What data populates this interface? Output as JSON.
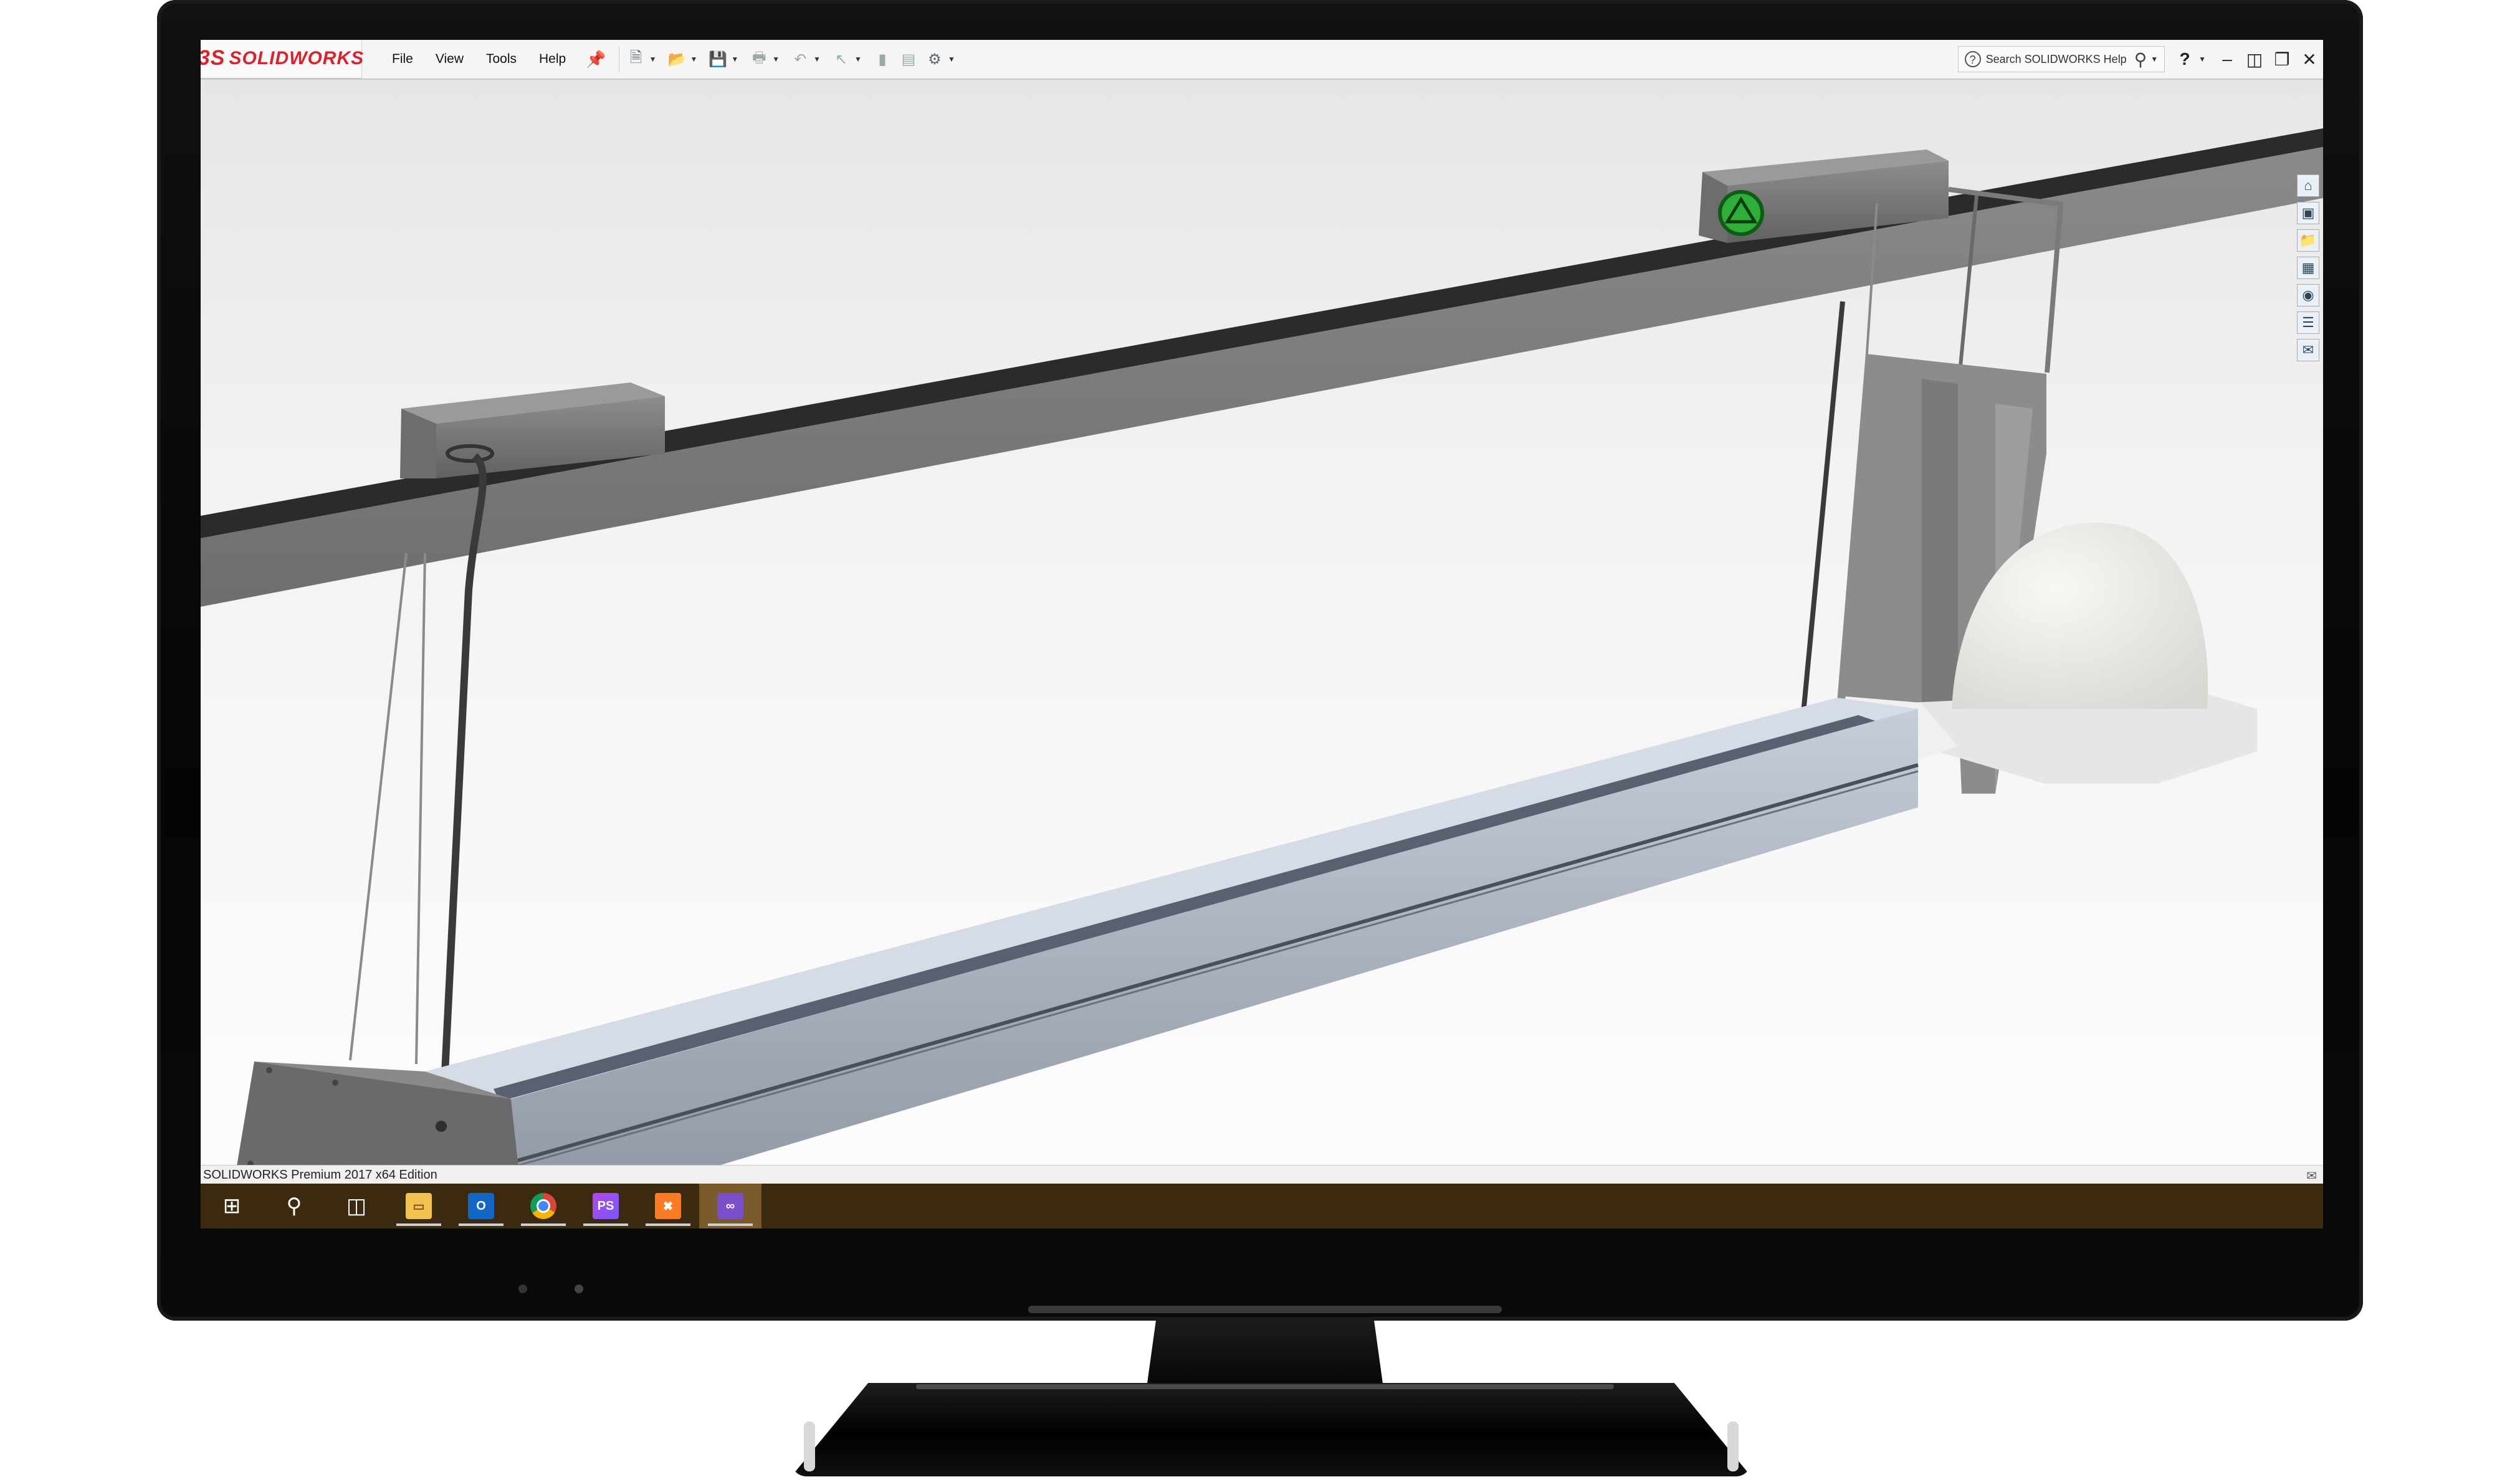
{
  "app": {
    "logo_text": "SOLIDWORKS",
    "logo_mark": "3S",
    "brand_color": "#d8232a"
  },
  "menu": {
    "items": [
      "File",
      "View",
      "Tools",
      "Help"
    ]
  },
  "toolbar": {
    "icons": [
      "new-document-icon",
      "open-icon",
      "save-icon",
      "print-icon",
      "undo-icon",
      "select-icon",
      "rebuild-icon",
      "file-properties-icon",
      "options-gear-icon"
    ]
  },
  "search": {
    "placeholder": "Search SOLIDWORKS Help"
  },
  "task_pane": {
    "icons": [
      "home-icon",
      "parts-library-icon",
      "file-explorer-icon",
      "view-palette-icon",
      "appearances-icon",
      "custom-properties-icon",
      "forum-icon"
    ]
  },
  "status_bar": {
    "text": "SOLIDWORKS Premium 2017 x64 Edition"
  },
  "taskbar": {
    "items": [
      "start",
      "search",
      "task-view",
      "file-explorer",
      "outlook",
      "chrome",
      "phpstorm",
      "xampp",
      "visual-studio"
    ],
    "app_labels": {
      "phpstorm": "PS",
      "outlook": "O"
    },
    "colors": {
      "taskbar_bg": "#3b2a10",
      "focused": "#7a5a2a"
    }
  }
}
